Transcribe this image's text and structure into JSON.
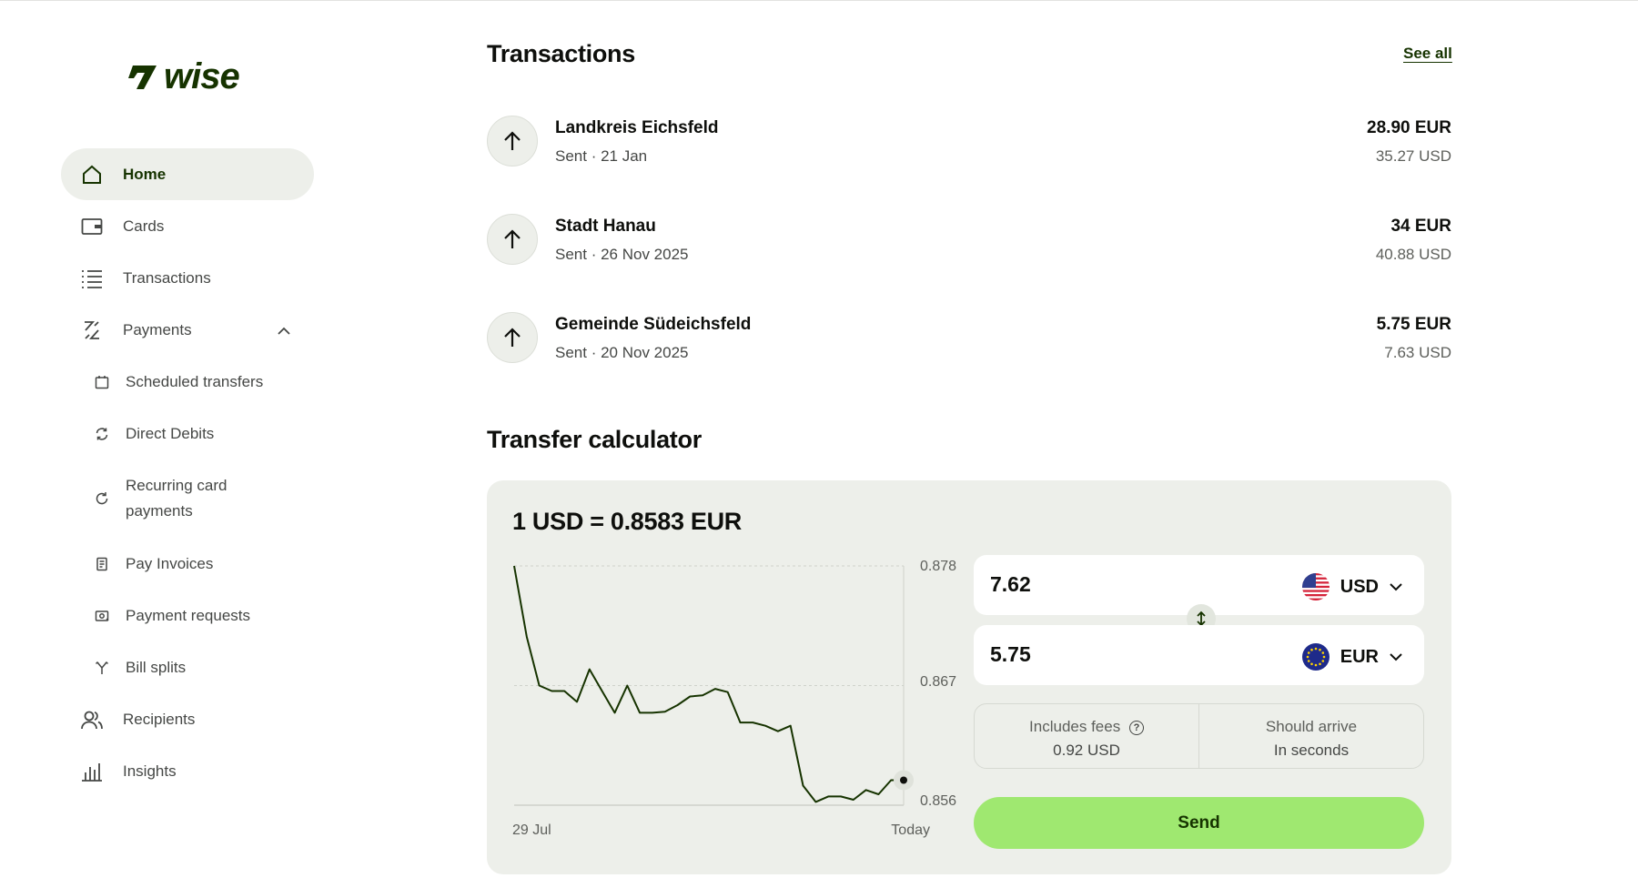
{
  "brand": {
    "name": "wise",
    "color": "#163300",
    "accent": "#9fe870"
  },
  "sidebar": {
    "items": [
      {
        "label": "Home",
        "icon": "home-icon",
        "active": true
      },
      {
        "label": "Cards",
        "icon": "card-icon"
      },
      {
        "label": "Transactions",
        "icon": "list-icon"
      },
      {
        "label": "Payments",
        "icon": "payments-icon",
        "expanded": true
      },
      {
        "label": "Scheduled transfers",
        "icon": "calendar-icon"
      },
      {
        "label": "Direct Debits",
        "icon": "refresh-icon"
      },
      {
        "label": "Recurring card payments",
        "icon": "recurring-icon"
      },
      {
        "label": "Pay Invoices",
        "icon": "invoice-icon"
      },
      {
        "label": "Payment requests",
        "icon": "request-icon"
      },
      {
        "label": "Bill splits",
        "icon": "split-icon"
      },
      {
        "label": "Recipients",
        "icon": "recipients-icon"
      },
      {
        "label": "Insights",
        "icon": "insights-icon"
      }
    ]
  },
  "transactions": {
    "title": "Transactions",
    "see_all": "See all",
    "items": [
      {
        "name": "Landkreis Eichsfeld",
        "sub": "Sent · 21 Jan",
        "amount": "28.90 EUR",
        "amount_alt": "35.27 USD"
      },
      {
        "name": "Stadt Hanau",
        "sub": "Sent · 26 Nov 2025",
        "amount": "34 EUR",
        "amount_alt": "40.88 USD"
      },
      {
        "name": "Gemeinde Südeichsfeld",
        "sub": "Sent · 20 Nov 2025",
        "amount": "5.75 EUR",
        "amount_alt": "7.63 USD"
      }
    ]
  },
  "calculator": {
    "title": "Transfer calculator",
    "rate": "1 USD = 0.8583 EUR",
    "send_value": "7.62",
    "send_currency": "USD",
    "receive_value": "5.75",
    "receive_currency": "EUR",
    "fees_label": "Includes fees",
    "fees_value": "0.92 USD",
    "arrive_label": "Should arrive",
    "arrive_value": "In seconds",
    "send_button": "Send"
  },
  "chart_data": {
    "type": "line",
    "x_start_label": "29 Jul",
    "x_end_label": "Today",
    "y_ticks": [
      "0.878",
      "0.867",
      "0.856"
    ],
    "ylim": [
      0.856,
      0.878
    ],
    "values": [
      0.878,
      0.8715,
      0.867,
      0.8665,
      0.8665,
      0.8655,
      0.8685,
      0.8665,
      0.8645,
      0.867,
      0.8645,
      0.8645,
      0.8646,
      0.8652,
      0.866,
      0.8661,
      0.8667,
      0.8664,
      0.8636,
      0.8636,
      0.8633,
      0.8628,
      0.8633,
      0.8578,
      0.8563,
      0.8568,
      0.8568,
      0.8565,
      0.8574,
      0.857,
      0.8583,
      0.8583
    ],
    "grid": true,
    "color": "#163300"
  }
}
